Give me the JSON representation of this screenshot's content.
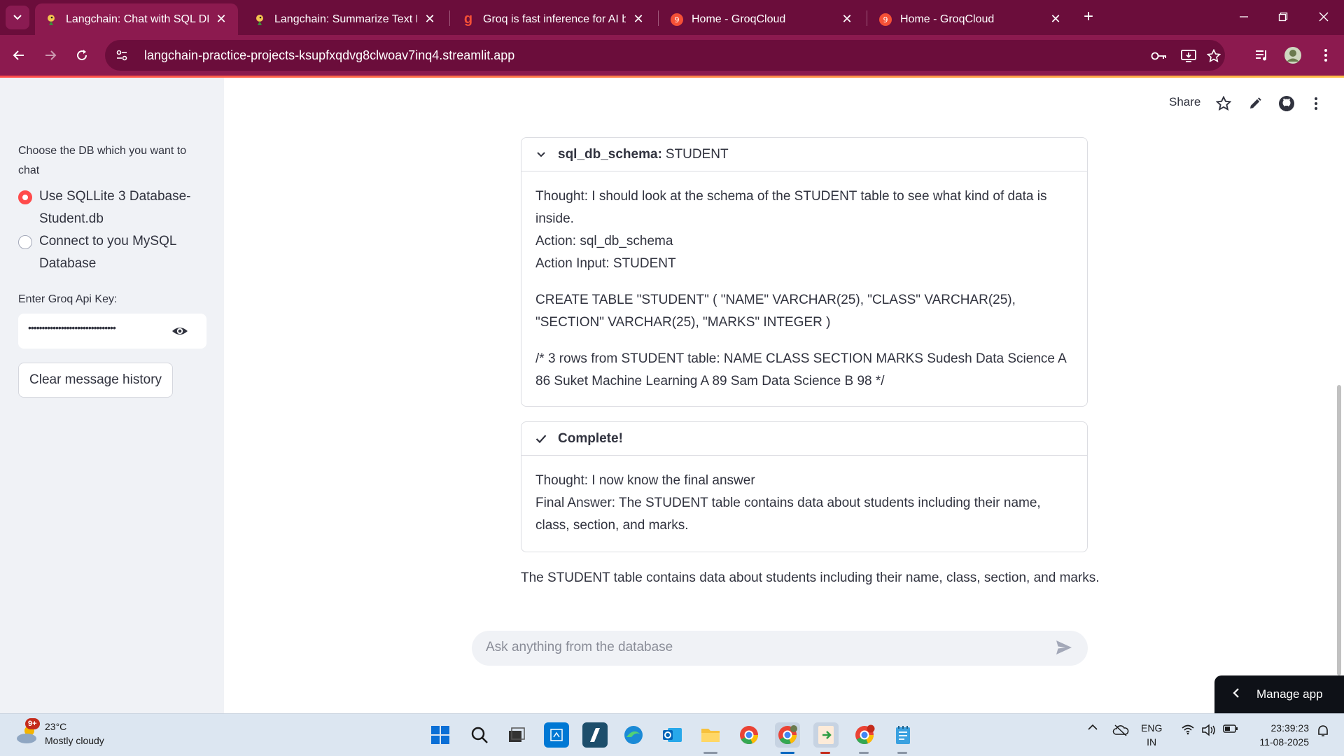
{
  "browser": {
    "tabs": [
      {
        "title": "Langchain: Chat with SQL DB - S",
        "favicon": "parrot-icon",
        "active": true
      },
      {
        "title": "Langchain: Summarize Text Fron",
        "favicon": "parrot-icon",
        "active": false
      },
      {
        "title": "Groq is fast inference for AI buil",
        "favicon": "groq-g-icon",
        "active": false
      },
      {
        "title": "Home - GroqCloud",
        "favicon": "groq-circle-icon",
        "active": false
      },
      {
        "title": "Home - GroqCloud",
        "favicon": "groq-circle-icon",
        "active": false
      }
    ],
    "close_glyph": "✕",
    "new_tab_glyph": "+",
    "url": "langchain-practice-projects-ksupfxqdvg8clwoav7inq4.streamlit.app",
    "theme_color": "#8c1a4f"
  },
  "sidebar": {
    "db_label_line1": "Choose the DB which you want to",
    "db_label_line2": "chat",
    "options": [
      {
        "label": "Use SQLLite 3 Database-Student.db",
        "selected": true
      },
      {
        "label": "Connect to you MySQL Database",
        "selected": false
      }
    ],
    "api_key_label": "Enter Groq Api Key:",
    "api_key_masked": "••••••••••••••••••••••••••••••••",
    "clear_button": "Clear message history"
  },
  "header": {
    "share_label": "Share"
  },
  "expanders": [
    {
      "title_bold": "sql_db_schema:",
      "title_rest": "STUDENT",
      "state_icon": "chevron-down-icon",
      "paragraphs": [
        "Thought: I should look at the schema of the STUDENT table to see what kind of data is inside.",
        "Action: sql_db_schema",
        "Action Input: STUDENT",
        "CREATE TABLE \"STUDENT\" ( \"NAME\" VARCHAR(25), \"CLASS\" VARCHAR(25), \"SECTION\" VARCHAR(25), \"MARKS\" INTEGER )",
        "/* 3 rows from STUDENT table: NAME CLASS SECTION MARKS Sudesh Data Science A 86 Suket Machine Learning A 89 Sam Data Science B 98 */"
      ]
    },
    {
      "title_bold": "Complete!",
      "title_rest": "",
      "state_icon": "check-icon",
      "paragraphs": [
        "Thought: I now know the final answer",
        "Final Answer: The STUDENT table contains data about students including their name, class, section, and marks."
      ]
    }
  ],
  "final_message": "The STUDENT table contains data about students including their name, class, section, and marks.",
  "chat_input": {
    "placeholder": "Ask anything from the database"
  },
  "manage_app": "Manage app",
  "taskbar": {
    "weather_temp": "23°C",
    "weather_desc": "Mostly cloudy",
    "weather_badge": "9+",
    "lang_line1": "ENG",
    "lang_line2": "IN",
    "time": "23:39:23",
    "date": "11-08-2025"
  }
}
